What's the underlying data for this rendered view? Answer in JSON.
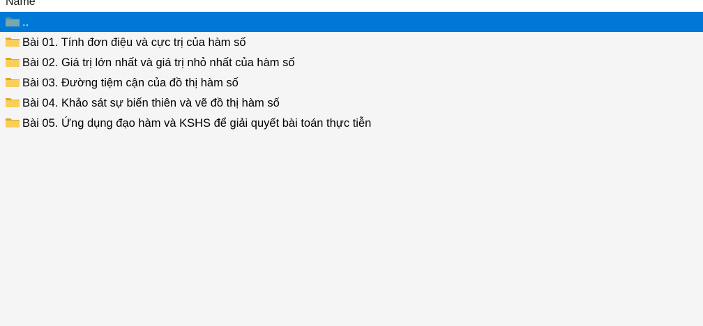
{
  "header": {
    "column_label": "Name"
  },
  "list": {
    "items": [
      {
        "label": "..",
        "icon": "parent-folder-icon",
        "selected": true
      },
      {
        "label": "Bài 01. Tính đơn điệu và cực trị của hàm số",
        "icon": "folder-icon",
        "selected": false
      },
      {
        "label": "Bài 02. Giá trị lớn nhất và giá trị nhỏ nhất của hàm số",
        "icon": "folder-icon",
        "selected": false
      },
      {
        "label": "Bài 03. Đường tiệm cận của đồ thị hàm số",
        "icon": "folder-icon",
        "selected": false
      },
      {
        "label": "Bài 04. Khảo sát sự biến thiên và vẽ đồ thị hàm số",
        "icon": "folder-icon",
        "selected": false
      },
      {
        "label": "Bài 05. Ứng dụng đạo hàm và KSHS để giải quyết bài toán thực tiễn",
        "icon": "folder-icon",
        "selected": false
      }
    ]
  },
  "colors": {
    "background": "#f5f5f5",
    "selection": "#0078d7",
    "folder_yellow": "#f6c342",
    "parent_folder": "#6b9aa0"
  }
}
